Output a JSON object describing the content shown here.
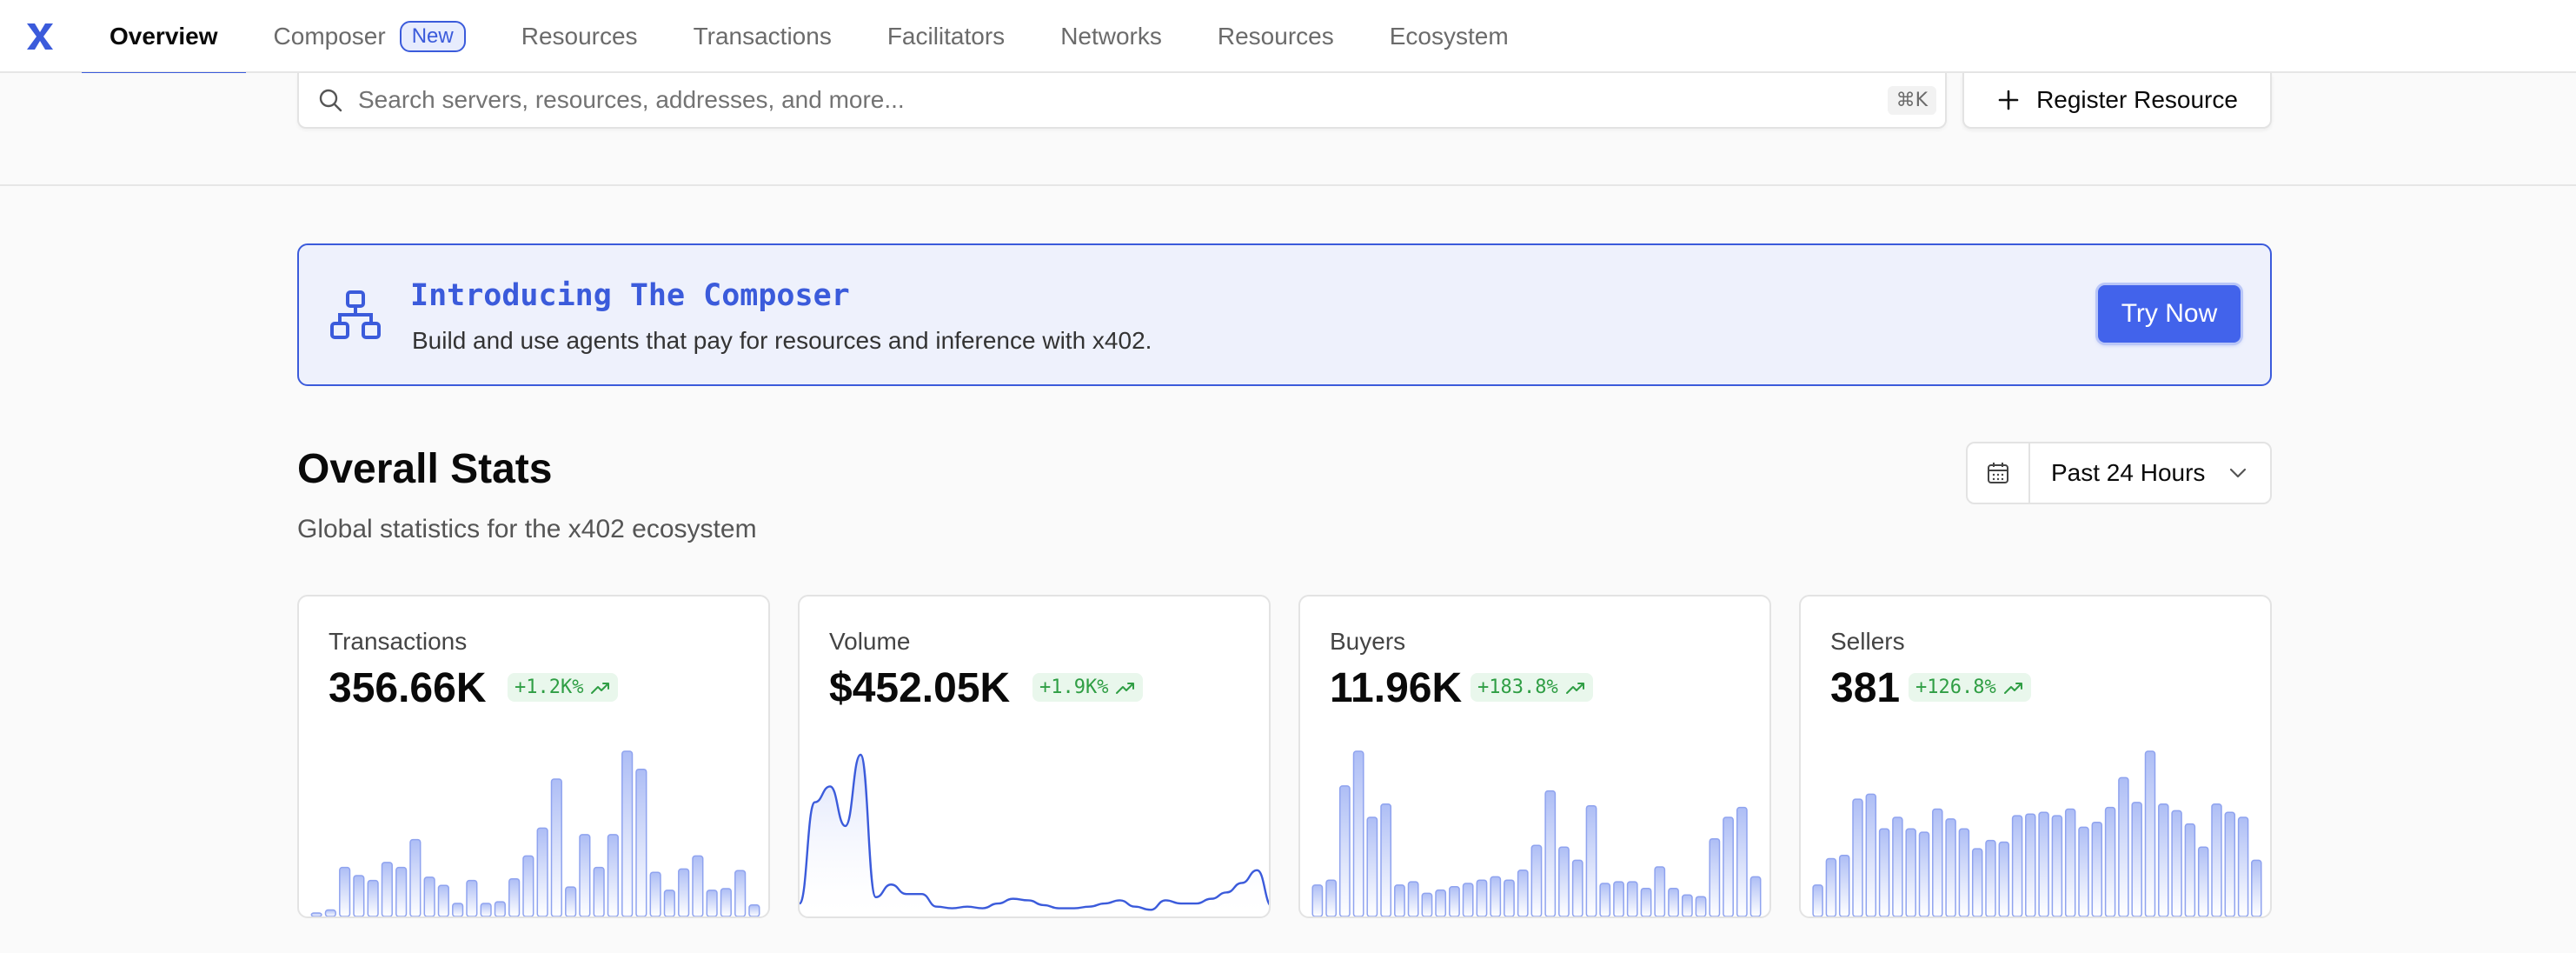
{
  "nav": {
    "tabs": [
      {
        "label": "Overview"
      },
      {
        "label": "Composer",
        "badge": "New"
      },
      {
        "label": "Resources"
      },
      {
        "label": "Transactions"
      },
      {
        "label": "Facilitators"
      },
      {
        "label": "Networks"
      },
      {
        "label": "Resources"
      },
      {
        "label": "Ecosystem"
      }
    ],
    "active_tab": "Overview"
  },
  "search": {
    "placeholder": "Search servers, resources, addresses, and more...",
    "shortcut": "⌘K"
  },
  "register_button": {
    "label": "Register Resource"
  },
  "banner": {
    "title": "Introducing The Composer",
    "subtitle": "Build and use agents that pay for resources and inference with x402.",
    "cta": "Try Now"
  },
  "stats": {
    "title": "Overall Stats",
    "subtitle": "Global statistics for the x402 ecosystem",
    "range": "Past 24 Hours"
  },
  "colors": {
    "accent": "#3b5bdb",
    "positive": "#2f9e44"
  },
  "cards": [
    {
      "label": "Transactions",
      "value": "356.66K",
      "delta": "+1.2K%"
    },
    {
      "label": "Volume",
      "value": "$452.05K",
      "delta": "+1.9K%"
    },
    {
      "label": "Buyers",
      "value": "11.96K",
      "delta": "+183.8%"
    },
    {
      "label": "Sellers",
      "value": "381",
      "delta": "+126.8%"
    }
  ],
  "chart_data": [
    {
      "type": "bar",
      "series": [
        {
          "values": [
            2,
            4,
            30,
            25,
            22,
            33,
            30,
            47,
            24,
            19,
            8,
            22,
            8,
            9,
            23,
            37,
            54,
            84,
            18,
            50,
            30,
            50,
            101,
            90,
            27,
            16,
            29,
            37,
            16,
            17,
            28,
            7
          ]
        }
      ]
    },
    {
      "type": "area",
      "series": [
        {
          "values": [
            6,
            70,
            80,
            55,
            100,
            10,
            18,
            12,
            12,
            4,
            3,
            4,
            3,
            6,
            9,
            8,
            5,
            3,
            3,
            4,
            6,
            8,
            4,
            2,
            8,
            6,
            6,
            9,
            13,
            19,
            27,
            4
          ]
        }
      ]
    },
    {
      "type": "bar",
      "series": [
        {
          "values": [
            19,
            22,
            79,
            100,
            60,
            68,
            19,
            21,
            14,
            16,
            18,
            20,
            22,
            24,
            22,
            28,
            43,
            76,
            42,
            34,
            67,
            20,
            21,
            21,
            17,
            30,
            17,
            13,
            12,
            47,
            60,
            66,
            24
          ]
        }
      ]
    },
    {
      "type": "bar",
      "series": [
        {
          "values": [
            19,
            35,
            37,
            71,
            74,
            53,
            60,
            53,
            51,
            65,
            59,
            53,
            41,
            46,
            45,
            61,
            62,
            63,
            61,
            65,
            54,
            57,
            66,
            84,
            69,
            100,
            68,
            64,
            56,
            42,
            68,
            63,
            60,
            34
          ]
        }
      ]
    }
  ]
}
